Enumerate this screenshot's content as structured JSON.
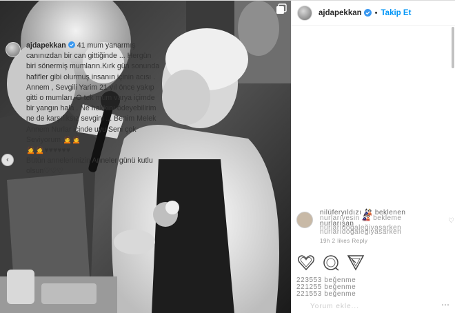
{
  "header": {
    "username": "ajdapekkan",
    "separator": "•",
    "follow_label": "Takip Et"
  },
  "caption": {
    "username": "ajdapekkan",
    "lines": [
      "41 mum yanarmış canınızdan bir can gittiğinde ... Hergün biri sönermiş mumların.Kırk gün sonunda hafifler gibi olurmuş insanın içinin acısı .",
      "Annem , Sevgili Yarim 21 yıl önce yakıp gitti o mumları. O tek mum varya içimde bir yangın hala . Ne hakkını ödeyebilirim ne de karşılıksız sevgini ... Benim Melek Annem Nurlar içinde uyu Seni çok Seviyorum 🙍🙍",
      "🙍🙍♥♥♥♥♥♥",
      "Bütün annelerimizin Anneler günü kutlu olsun♡♡♡"
    ]
  },
  "comment_ghost": {
    "line1": "nilüferyıldızı 🎎 beklenen",
    "line2": "nurlarıyesin 🎎 bekleme",
    "line3": "nurlarışan",
    "line4": "nurlarıdoğaleğiyasarken",
    "line5": "nurlarıdoğaleğiyasarken",
    "line6": "19h  2 likes  Reply"
  },
  "stats": {
    "line1": "223553 beğenme",
    "line2": "221255 beğenme",
    "line3": "221553 beğenme"
  },
  "input_placeholder": "Yorum ekle..."
}
